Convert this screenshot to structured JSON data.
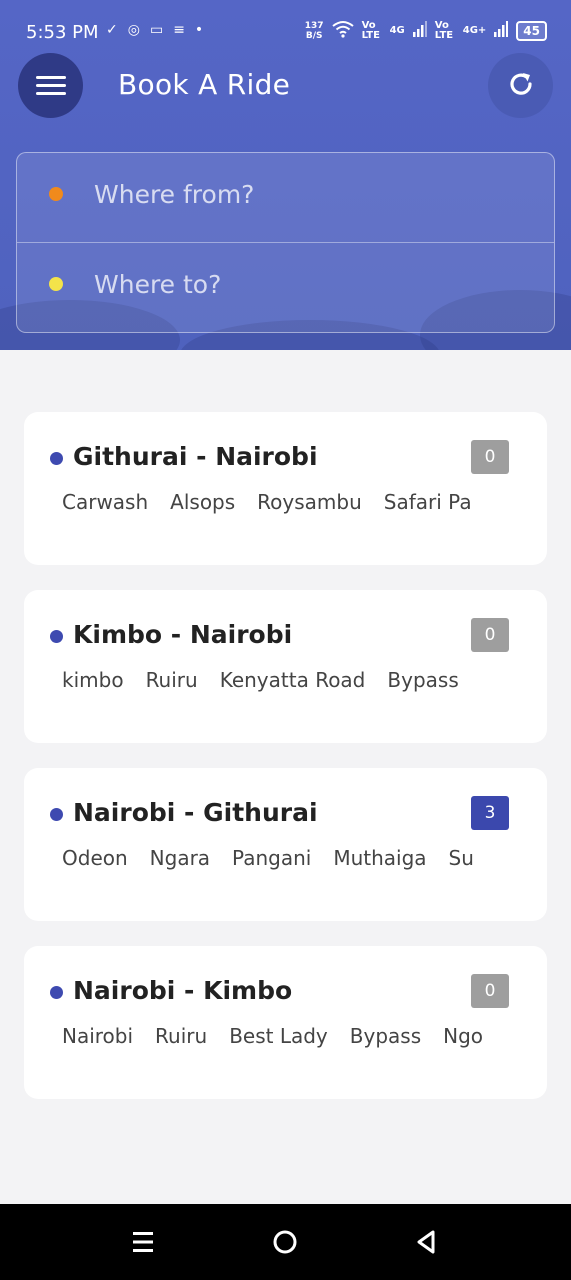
{
  "status_bar": {
    "time": "5:53 PM",
    "net_speed_value": "137",
    "net_speed_unit": "B/S",
    "sim1_tech": "Vo LTE",
    "sim1_gen": "4G",
    "sim2_tech": "Vo LTE",
    "sim2_gen": "4G+",
    "battery": "45"
  },
  "header": {
    "title": "Book A Ride",
    "menu_icon": "hamburger-menu-icon",
    "refresh_icon": "refresh-icon",
    "accent": "#5061bf"
  },
  "search": {
    "from_placeholder": "Where from?",
    "to_placeholder": "Where to?",
    "from_dot_color": "#f08a1c",
    "to_dot_color": "#f3e34a"
  },
  "routes": [
    {
      "title": "Githurai - Nairobi",
      "count": "0",
      "count_active": false,
      "stops": [
        "Carwash",
        "Alsops",
        "Roysambu",
        "Safari Pa"
      ]
    },
    {
      "title": "Kimbo - Nairobi",
      "count": "0",
      "count_active": false,
      "stops": [
        "kimbo",
        "Ruiru",
        "Kenyatta Road",
        "Bypass"
      ]
    },
    {
      "title": "Nairobi - Githurai",
      "count": "3",
      "count_active": true,
      "stops": [
        "Odeon",
        "Ngara",
        "Pangani",
        "Muthaiga",
        "Su"
      ]
    },
    {
      "title": "Nairobi - Kimbo",
      "count": "0",
      "count_active": false,
      "stops": [
        "Nairobi",
        "Ruiru",
        "Best Lady",
        "Bypass",
        "Ngo"
      ]
    }
  ],
  "badge_colors": {
    "inactive": "#9e9e9e",
    "active": "#3b48ad"
  },
  "nav_bar": {
    "recents_icon": "recents-icon",
    "home_icon": "home-icon",
    "back_icon": "back-icon"
  }
}
